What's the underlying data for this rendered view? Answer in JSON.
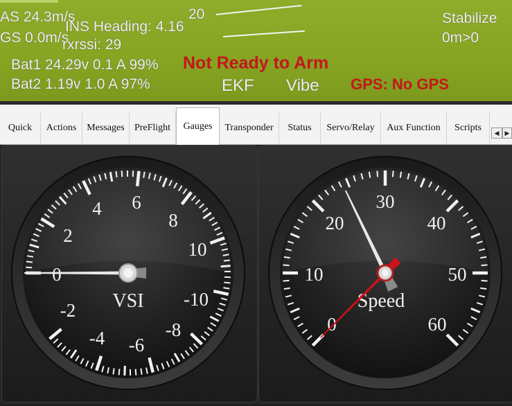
{
  "hud": {
    "airspeed": "AS 24.3m/s",
    "groundspeed": "GS 0.0m/s",
    "ins_heading": "INS Heading: 4.16",
    "rxrssi": "rxrssi: 29",
    "pitch_mark": "20",
    "mode": "Stabilize",
    "distance": "0m>0",
    "bat1": "Bat1 24.29v 0.1 A 99%",
    "bat2": "Bat2 1.19v 1.0 A 97%",
    "arm_status": "Not Ready to Arm",
    "ekf": "EKF",
    "vibe": "Vibe",
    "gps_status": "GPS: No GPS"
  },
  "tabs": [
    {
      "label": "Quick"
    },
    {
      "label": "Actions"
    },
    {
      "label": "Messages"
    },
    {
      "label": "PreFlight"
    },
    {
      "label": "Gauges",
      "active": true
    },
    {
      "label": "Transponder"
    },
    {
      "label": "Status"
    },
    {
      "label": "Servo/Relay"
    },
    {
      "label": "Aux Function"
    },
    {
      "label": "Scripts"
    }
  ],
  "scroll": {
    "left_icon": "◀",
    "right_icon": "▶"
  },
  "vsi_gauge": {
    "label": "VSI",
    "value": 0,
    "tick_labels": [
      "-2",
      "-4",
      "-6",
      "-8",
      "-10",
      "0",
      "2",
      "4",
      "6",
      "8",
      "10"
    ]
  },
  "speed_gauge": {
    "label": "Speed",
    "value": 24.3,
    "ground_speed": 0,
    "tick_labels": [
      "0",
      "10",
      "20",
      "30",
      "40",
      "50",
      "60"
    ]
  },
  "colors": {
    "hud_green": "#86a322",
    "alert_red": "#c4161c",
    "needle_white": "#e8e8e8",
    "needle_red": "#d0101a"
  }
}
